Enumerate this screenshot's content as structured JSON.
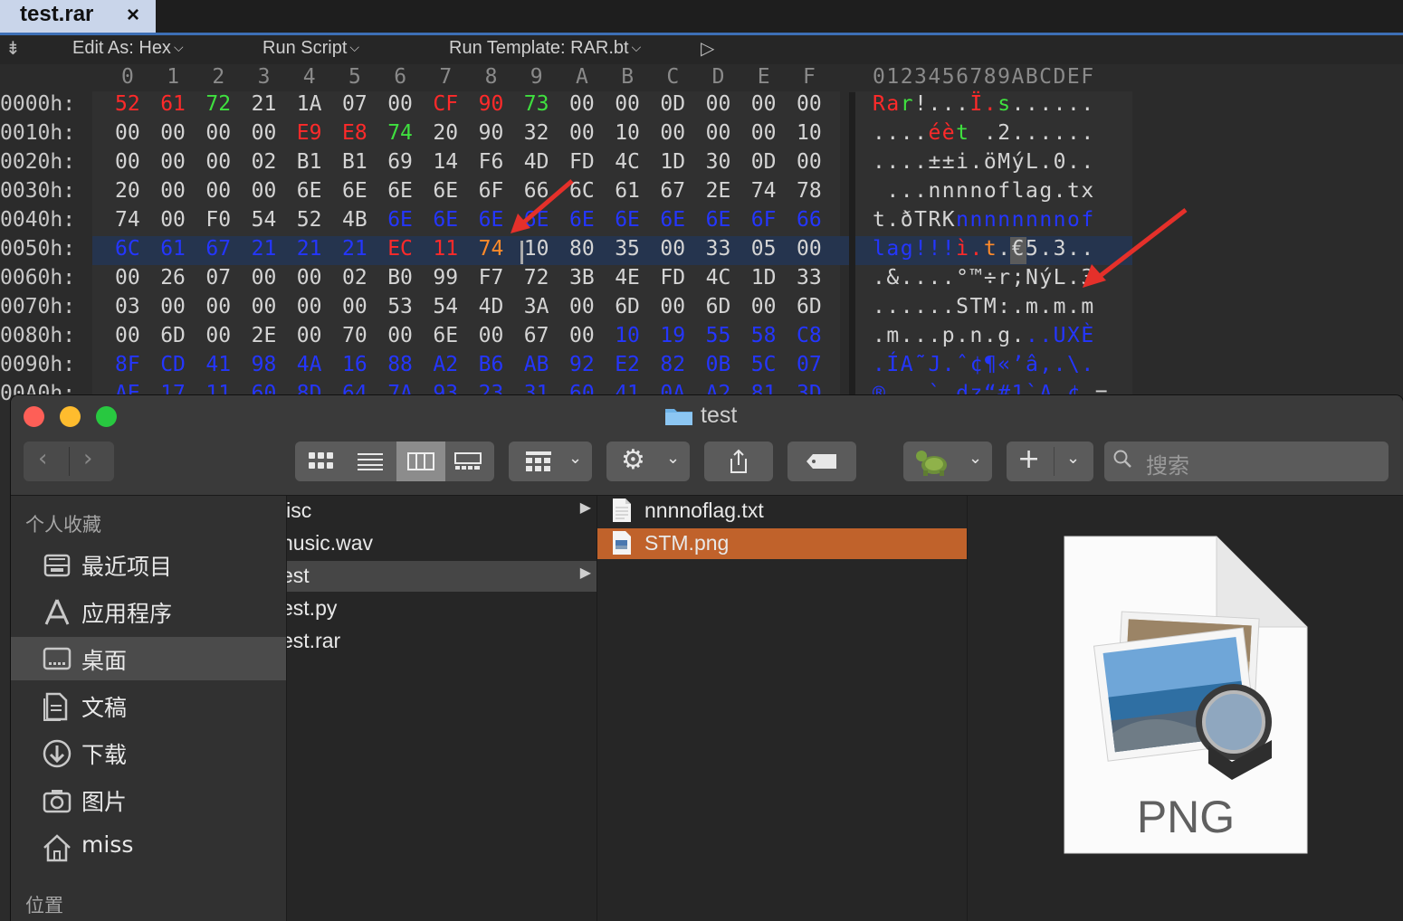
{
  "hex_editor": {
    "tab_title": "test.rar",
    "tab_close": "×",
    "toolbar": {
      "edit_as": "Edit As: Hex",
      "run_script": "Run Script",
      "run_template": "Run Template: RAR.bt",
      "chevron": "⌵",
      "collapse": "⇟",
      "play": "▷"
    },
    "column_headers": [
      "0",
      "1",
      "2",
      "3",
      "4",
      "5",
      "6",
      "7",
      "8",
      "9",
      "A",
      "B",
      "C",
      "D",
      "E",
      "F"
    ],
    "ascii_header": "0123456789ABCDEF",
    "rows": [
      {
        "offset": "0000h:",
        "bytes": [
          "52",
          "61",
          "72",
          "21",
          "1A",
          "07",
          "00",
          "CF",
          "90",
          "73",
          "00",
          "00",
          "0D",
          "00",
          "00",
          "00"
        ],
        "colors": [
          "r",
          "r",
          "g",
          "",
          "",
          "",
          "",
          "r",
          "r",
          "g",
          "",
          "",
          "",
          "",
          "",
          ""
        ],
        "ascii": "Rar!...Ï.s......"
      },
      {
        "offset": "0010h:",
        "bytes": [
          "00",
          "00",
          "00",
          "00",
          "E9",
          "E8",
          "74",
          "20",
          "90",
          "32",
          "00",
          "10",
          "00",
          "00",
          "00",
          "10"
        ],
        "colors": [
          "",
          "",
          "",
          "",
          "r",
          "r",
          "g",
          "",
          "",
          "",
          "",
          "",
          "",
          "",
          "",
          ""
        ],
        "ascii": "....éèt .2......"
      },
      {
        "offset": "0020h:",
        "bytes": [
          "00",
          "00",
          "00",
          "02",
          "B1",
          "B1",
          "69",
          "14",
          "F6",
          "4D",
          "FD",
          "4C",
          "1D",
          "30",
          "0D",
          "00"
        ],
        "colors": [
          "",
          "",
          "",
          "",
          "",
          "",
          "",
          "",
          "",
          "",
          "",
          "",
          "",
          "",
          "",
          ""
        ],
        "ascii": "....±±i.öMýL.0.."
      },
      {
        "offset": "0030h:",
        "bytes": [
          "20",
          "00",
          "00",
          "00",
          "6E",
          "6E",
          "6E",
          "6E",
          "6F",
          "66",
          "6C",
          "61",
          "67",
          "2E",
          "74",
          "78"
        ],
        "colors": [
          "",
          "",
          "",
          "",
          "",
          "",
          "",
          "",
          "",
          "",
          "",
          "",
          "",
          "",
          "",
          ""
        ],
        "ascii": " ...nnnnoflag.tx"
      },
      {
        "offset": "0040h:",
        "bytes": [
          "74",
          "00",
          "F0",
          "54",
          "52",
          "4B",
          "6E",
          "6E",
          "6E",
          "6E",
          "6E",
          "6E",
          "6E",
          "6E",
          "6F",
          "66"
        ],
        "colors": [
          "",
          "",
          "",
          "",
          "",
          "",
          "b",
          "b",
          "b",
          "b",
          "b",
          "b",
          "b",
          "b",
          "b",
          "b"
        ],
        "ascii": "t.ðTRKnnnnnnnnof"
      },
      {
        "offset": "0050h:",
        "bytes": [
          "6C",
          "61",
          "67",
          "21",
          "21",
          "21",
          "EC",
          "11",
          "74",
          "10",
          "80",
          "35",
          "00",
          "33",
          "05",
          "00"
        ],
        "colors": [
          "b",
          "b",
          "b",
          "b",
          "b",
          "b",
          "r",
          "r",
          "o",
          "",
          "",
          "",
          "",
          "",
          "",
          ""
        ],
        "ascii": "lag!!!ì.t.€5.3.."
      },
      {
        "offset": "0060h:",
        "bytes": [
          "00",
          "26",
          "07",
          "00",
          "00",
          "02",
          "B0",
          "99",
          "F7",
          "72",
          "3B",
          "4E",
          "FD",
          "4C",
          "1D",
          "33"
        ],
        "colors": [
          "",
          "",
          "",
          "",
          "",
          "",
          "",
          "",
          "",
          "",
          "",
          "",
          "",
          "",
          "",
          ""
        ],
        "ascii": ".&....°™÷r;NýL.3"
      },
      {
        "offset": "0070h:",
        "bytes": [
          "03",
          "00",
          "00",
          "00",
          "00",
          "00",
          "53",
          "54",
          "4D",
          "3A",
          "00",
          "6D",
          "00",
          "6D",
          "00",
          "6D"
        ],
        "colors": [
          "",
          "",
          "",
          "",
          "",
          "",
          "",
          "",
          "",
          "",
          "",
          "",
          "",
          "",
          "",
          ""
        ],
        "ascii": "......STM:.m.m.m"
      },
      {
        "offset": "0080h:",
        "bytes": [
          "00",
          "6D",
          "00",
          "2E",
          "00",
          "70",
          "00",
          "6E",
          "00",
          "67",
          "00",
          "10",
          "19",
          "55",
          "58",
          "C8"
        ],
        "colors": [
          "",
          "",
          "",
          "",
          "",
          "",
          "",
          "",
          "",
          "",
          "",
          "b",
          "b",
          "b",
          "b",
          "b"
        ],
        "ascii": ".m...p.n.g...UXÈ"
      },
      {
        "offset": "0090h:",
        "bytes": [
          "8F",
          "CD",
          "41",
          "98",
          "4A",
          "16",
          "88",
          "A2",
          "B6",
          "AB",
          "92",
          "E2",
          "82",
          "0B",
          "5C",
          "07"
        ],
        "colors": [
          "b",
          "b",
          "b",
          "b",
          "b",
          "b",
          "b",
          "b",
          "b",
          "b",
          "b",
          "b",
          "b",
          "b",
          "b",
          "b"
        ],
        "ascii": ".ÍA˜J.ˆ¢¶«’â‚.\\."
      },
      {
        "offset": "00A0h:",
        "bytes": [
          "AE",
          "17",
          "11",
          "60",
          "8D",
          "64",
          "7A",
          "93",
          "23",
          "31",
          "60",
          "41",
          "0A",
          "A2",
          "81",
          "3D"
        ],
        "colors": [
          "b",
          "b",
          "b",
          "b",
          "b",
          "b",
          "b",
          "b",
          "b",
          "b",
          "b",
          "b",
          "b",
          "b",
          "b",
          "b"
        ],
        "ascii": "®...`.dz“#1`A.¢.="
      }
    ]
  },
  "finder": {
    "title": "test",
    "search_placeholder": "搜索",
    "sidebar": {
      "favorites_header": "个人收藏",
      "items": [
        {
          "label": "最近项目",
          "icon": "recents-icon"
        },
        {
          "label": "应用程序",
          "icon": "applications-icon"
        },
        {
          "label": "桌面",
          "icon": "desktop-icon"
        },
        {
          "label": "文稿",
          "icon": "documents-icon"
        },
        {
          "label": "下载",
          "icon": "downloads-icon"
        },
        {
          "label": "图片",
          "icon": "pictures-icon"
        },
        {
          "label": "miss",
          "icon": "home-icon"
        }
      ],
      "locations_header": "位置"
    },
    "column1": [
      "lisc",
      "nusic.wav",
      "est",
      "est.py",
      "est.rar"
    ],
    "column2": [
      "nnnnoflag.txt",
      "STM.png"
    ],
    "preview_label": "PNG",
    "colors": {
      "selection": "#c0622b",
      "accent_blue": "#2436ff",
      "hex_red": "#ff2a2a",
      "hex_green": "#3fe03f",
      "arrow_red": "#e5302a"
    }
  }
}
